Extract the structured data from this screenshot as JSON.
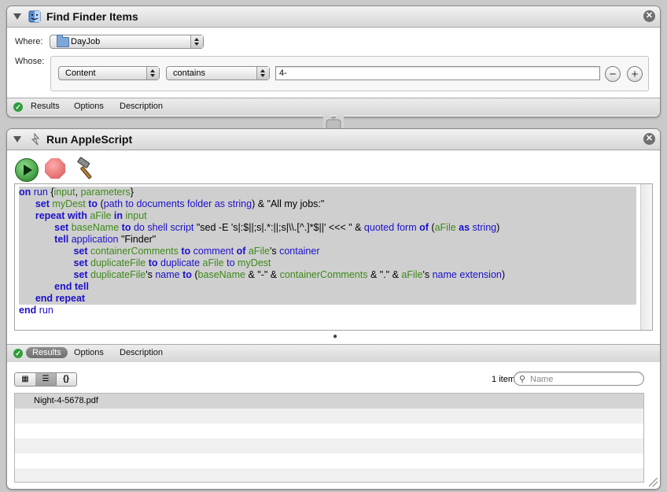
{
  "find_action": {
    "title": "Find Finder Items",
    "where_label": "Where:",
    "where_value": "DayJob",
    "whose_label": "Whose:",
    "criteria_field": "Content",
    "criteria_operator": "contains",
    "criteria_value": "4-",
    "footer_tabs": [
      "Results",
      "Options",
      "Description"
    ]
  },
  "applescript_action": {
    "title": "Run AppleScript",
    "code_lines": [
      [
        {
          "t": "on",
          "c": "kw"
        },
        {
          "t": " "
        },
        {
          "t": "run",
          "c": "cmd"
        },
        {
          "t": " {"
        },
        {
          "t": "input",
          "c": "var"
        },
        {
          "t": ", "
        },
        {
          "t": "parameters",
          "c": "var"
        },
        {
          "t": "}"
        }
      ],
      [
        {
          "t": "      "
        },
        {
          "t": "set",
          "c": "kw"
        },
        {
          "t": " "
        },
        {
          "t": "myDest",
          "c": "var"
        },
        {
          "t": " "
        },
        {
          "t": "to",
          "c": "kw"
        },
        {
          "t": " ("
        },
        {
          "t": "path to",
          "c": "cmd"
        },
        {
          "t": " "
        },
        {
          "t": "documents folder",
          "c": "cmd"
        },
        {
          "t": " "
        },
        {
          "t": "as",
          "c": "cmd"
        },
        {
          "t": " "
        },
        {
          "t": "string",
          "c": "cmd"
        },
        {
          "t": ") & \"All my jobs:\""
        }
      ],
      [
        {
          "t": "      "
        },
        {
          "t": "repeat",
          "c": "kw"
        },
        {
          "t": " "
        },
        {
          "t": "with",
          "c": "kw"
        },
        {
          "t": " "
        },
        {
          "t": "aFile",
          "c": "var"
        },
        {
          "t": " "
        },
        {
          "t": "in",
          "c": "kw"
        },
        {
          "t": " "
        },
        {
          "t": "input",
          "c": "var"
        }
      ],
      [
        {
          "t": "             "
        },
        {
          "t": "set",
          "c": "kw"
        },
        {
          "t": " "
        },
        {
          "t": "baseName",
          "c": "var"
        },
        {
          "t": " "
        },
        {
          "t": "to",
          "c": "kw"
        },
        {
          "t": " "
        },
        {
          "t": "do shell script",
          "c": "cmd"
        },
        {
          "t": " \"sed -E 's|:$||;s|.*:||;s|\\\\.[^.]*$||' <<< \" & "
        },
        {
          "t": "quoted form",
          "c": "cmd"
        },
        {
          "t": " "
        },
        {
          "t": "of",
          "c": "kw"
        },
        {
          "t": " ("
        },
        {
          "t": "aFile",
          "c": "var"
        },
        {
          "t": " "
        },
        {
          "t": "as",
          "c": "kw"
        },
        {
          "t": " "
        },
        {
          "t": "string",
          "c": "cmd"
        },
        {
          "t": ")"
        }
      ],
      [
        {
          "t": "             "
        },
        {
          "t": "tell",
          "c": "kw"
        },
        {
          "t": " "
        },
        {
          "t": "application",
          "c": "cmd"
        },
        {
          "t": " \"Finder\""
        }
      ],
      [
        {
          "t": "                    "
        },
        {
          "t": "set",
          "c": "kw"
        },
        {
          "t": " "
        },
        {
          "t": "containerComments",
          "c": "var"
        },
        {
          "t": " "
        },
        {
          "t": "to",
          "c": "kw"
        },
        {
          "t": " "
        },
        {
          "t": "comment",
          "c": "cmd"
        },
        {
          "t": " "
        },
        {
          "t": "of",
          "c": "kw"
        },
        {
          "t": " "
        },
        {
          "t": "aFile",
          "c": "var"
        },
        {
          "t": "'s "
        },
        {
          "t": "container",
          "c": "cmd"
        }
      ],
      [
        {
          "t": "                    "
        },
        {
          "t": "set",
          "c": "kw"
        },
        {
          "t": " "
        },
        {
          "t": "duplicateFile",
          "c": "var"
        },
        {
          "t": " "
        },
        {
          "t": "to",
          "c": "kw"
        },
        {
          "t": " "
        },
        {
          "t": "duplicate",
          "c": "cmd"
        },
        {
          "t": " "
        },
        {
          "t": "aFile",
          "c": "var"
        },
        {
          "t": " "
        },
        {
          "t": "to",
          "c": "cmd"
        },
        {
          "t": " "
        },
        {
          "t": "myDest",
          "c": "var"
        }
      ],
      [
        {
          "t": "                    "
        },
        {
          "t": "set",
          "c": "kw"
        },
        {
          "t": " "
        },
        {
          "t": "duplicateFile",
          "c": "var"
        },
        {
          "t": "'s "
        },
        {
          "t": "name",
          "c": "cmd"
        },
        {
          "t": " "
        },
        {
          "t": "to",
          "c": "kw"
        },
        {
          "t": " ("
        },
        {
          "t": "baseName",
          "c": "var"
        },
        {
          "t": " & \"-\" & "
        },
        {
          "t": "containerComments",
          "c": "var"
        },
        {
          "t": " & \".\" & "
        },
        {
          "t": "aFile",
          "c": "var"
        },
        {
          "t": "'s "
        },
        {
          "t": "name extension",
          "c": "cmd"
        },
        {
          "t": ")"
        }
      ],
      [
        {
          "t": "             "
        },
        {
          "t": "end",
          "c": "kw"
        },
        {
          "t": " "
        },
        {
          "t": "tell",
          "c": "kw"
        }
      ],
      [
        {
          "t": "      "
        },
        {
          "t": "end",
          "c": "kw"
        },
        {
          "t": " "
        },
        {
          "t": "repeat",
          "c": "kw"
        }
      ],
      [
        {
          "t": "end",
          "c": "kw"
        },
        {
          "t": " "
        },
        {
          "t": "run",
          "c": "cmd"
        }
      ]
    ],
    "footer_tabs": [
      "Results",
      "Options",
      "Description"
    ],
    "selected_tab": "Results",
    "view_buttons": [
      "icon-view",
      "list-view",
      "code-view"
    ],
    "item_count": "1 item",
    "search_placeholder": "Name",
    "results": [
      "Night-4-5678.pdf"
    ]
  }
}
